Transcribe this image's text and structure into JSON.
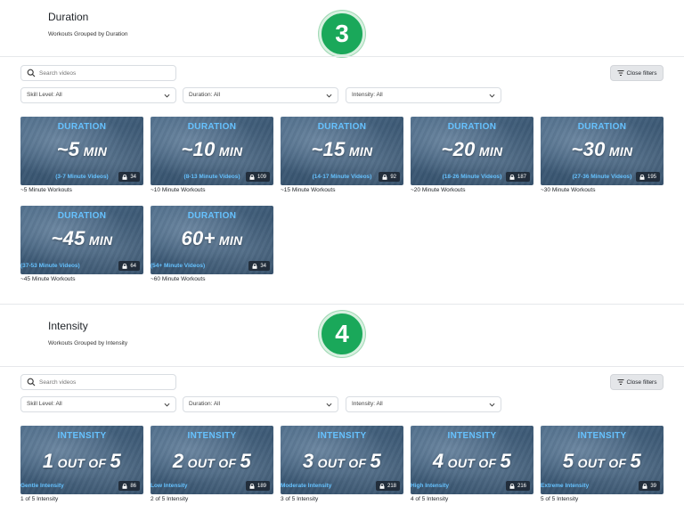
{
  "duration_section": {
    "title": "Duration",
    "subtitle": "Workouts Grouped by Duration",
    "step": "3",
    "search_placeholder": "Search videos",
    "close_filters": "Close filters",
    "filters": [
      "Skill Level: All",
      "Duration: All",
      "Intensity: All"
    ],
    "cards": [
      {
        "kicker": "DURATION",
        "num": "~5",
        "unit": " MIN",
        "note": "(3-7 Minute Videos)",
        "count": "34",
        "caption": "~5 Minute Workouts"
      },
      {
        "kicker": "DURATION",
        "num": "~10",
        "unit": " MIN",
        "note": "(8-13 Minute Videos)",
        "count": "109",
        "caption": "~10 Minute Workouts"
      },
      {
        "kicker": "DURATION",
        "num": "~15",
        "unit": " MIN",
        "note": "(14-17 Minute Videos)",
        "count": "92",
        "caption": "~15 Minute Workouts"
      },
      {
        "kicker": "DURATION",
        "num": "~20",
        "unit": " MIN",
        "note": "(18-26 Minute Videos)",
        "count": "187",
        "caption": "~20 Minute Workouts"
      },
      {
        "kicker": "DURATION",
        "num": "~30",
        "unit": " MIN",
        "note": "(27-36 Minute Videos)",
        "count": "195",
        "caption": "~30 Minute Workouts"
      },
      {
        "kicker": "DURATION",
        "num": "~45",
        "unit": " MIN",
        "note": "(37-53 Minute Videos)",
        "count": "64",
        "caption": "~45 Minute Workouts"
      },
      {
        "kicker": "DURATION",
        "num": "60+",
        "unit": " MIN",
        "note": "(54+ Minute Videos)",
        "count": "34",
        "caption": "~60 Minute Workouts"
      }
    ]
  },
  "intensity_section": {
    "title": "Intensity",
    "subtitle": "Workouts Grouped by Intensity",
    "step": "4",
    "search_placeholder": "Search videos",
    "close_filters": "Close filters",
    "filters": [
      "Skill Level: All",
      "Duration: All",
      "Intensity: All"
    ],
    "cards": [
      {
        "kicker": "INTENSITY",
        "num": "1",
        "unit": " OUT OF ",
        "num2": "5",
        "note": "Gentle Intensity",
        "count": "86",
        "caption": "1 of 5 Intensity"
      },
      {
        "kicker": "INTENSITY",
        "num": "2",
        "unit": " OUT OF ",
        "num2": "5",
        "note": "Low Intensity",
        "count": "189",
        "caption": "2 of 5 Intensity"
      },
      {
        "kicker": "INTENSITY",
        "num": "3",
        "unit": " OUT OF ",
        "num2": "5",
        "note": "Moderate Intensity",
        "count": "218",
        "caption": "3 of 5 Intensity"
      },
      {
        "kicker": "INTENSITY",
        "num": "4",
        "unit": " OUT OF ",
        "num2": "5",
        "note": "High Intensity",
        "count": "216",
        "caption": "4 of 5 Intensity"
      },
      {
        "kicker": "INTENSITY",
        "num": "5",
        "unit": " OUT OF ",
        "num2": "5",
        "note": "Extreme Intensity",
        "count": "39",
        "caption": "5 of 5 Intensity"
      }
    ]
  },
  "colors": {
    "badge_green": "#1aa85a",
    "kicker_blue": "#66c2ff",
    "thumb_dark": "#3d5a76"
  },
  "icons": [
    "search-icon",
    "filter-icon",
    "chevron-down-icon",
    "lock-icon"
  ]
}
